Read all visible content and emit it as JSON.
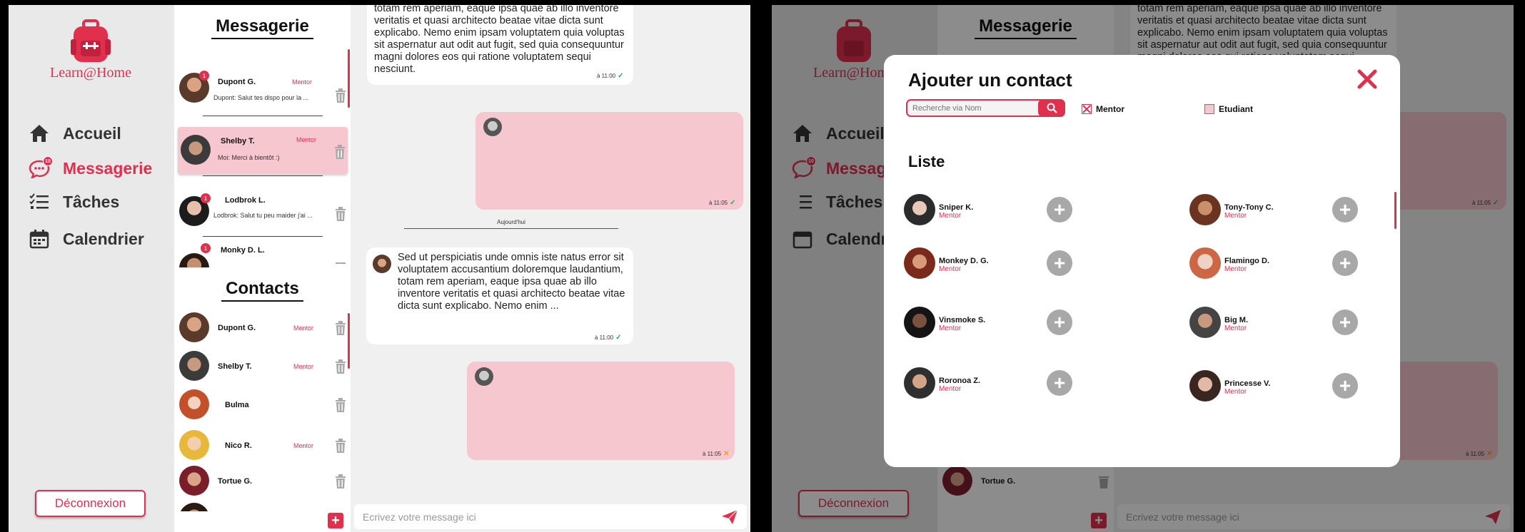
{
  "app": {
    "logo_text": "Learn@Home",
    "accent": "#e0304e",
    "pink": "#f6c7cf"
  },
  "nav": {
    "items": [
      {
        "label": "Accueil",
        "icon": "home-icon"
      },
      {
        "label": "Messagerie",
        "icon": "chat-bubble-icon",
        "badge": "10"
      },
      {
        "label": "Tâches",
        "icon": "checklist-icon"
      },
      {
        "label": "Calendrier",
        "icon": "calendar-icon"
      }
    ],
    "logout": "Déconnexion"
  },
  "messagerie": {
    "title": "Messagerie",
    "conversations": [
      {
        "name": "Dupont G.",
        "tag": "Mentor",
        "preview": "Dupont:  Salut tes dispo pour la ...",
        "badge": "1"
      },
      {
        "name": "Shelby T.",
        "tag": "Mentor",
        "preview": "Moi: Merci à bientôt :)"
      },
      {
        "name": "Lodbrok L.",
        "tag": "",
        "preview": "Lodbrok: Salut tu peu maider j'ai ...",
        "badge": "1"
      },
      {
        "name": "Monky D. L.",
        "tag": "",
        "preview": "",
        "badge": "1"
      }
    ]
  },
  "contacts": {
    "title": "Contacts",
    "items": [
      {
        "name": "Dupont G.",
        "tag": "Mentor"
      },
      {
        "name": "Shelby T.",
        "tag": "Mentor"
      },
      {
        "name": "Bulma",
        "tag": ""
      },
      {
        "name": "Nico R.",
        "tag": "Mentor"
      },
      {
        "name": "Tortue G.",
        "tag": ""
      }
    ]
  },
  "chat": {
    "msg1_text": "totam rem aperiam, eaque ipsa quae ab illo inventore veritatis et quasi architecto beatae vitae dicta sunt explicabo. Nemo enim ipsam voluptatem quia voluptas sit aspernatur aut odit aut fugit, sed quia consequuntur magni dolores eos qui ratione voluptatem sequi nesciunt.",
    "msg1_time": "à 11:00",
    "msg2_time": "à 11:05",
    "day_label": "Aujourd'hui",
    "msg3_text": "Sed ut perspiciatis unde omnis iste natus error sit voluptatem accusantium doloremque laudantium, totam rem aperiam, eaque ipsa quae ab illo inventore veritatis et quasi architecto beatae vitae dicta sunt explicabo. Nemo enim ...",
    "msg3_time": "à 11:00",
    "msg4_time": "à 11:05",
    "input_placeholder": "Ecrivez votre message ici"
  },
  "modal": {
    "title": "Ajouter un contact",
    "search_placeholder": "Recherche via Nom",
    "filter_mentor": "Mentor",
    "filter_student": "Etudiant",
    "list_title": "Liste",
    "contacts": [
      {
        "name": "Sniper K.",
        "tag": "Mentor"
      },
      {
        "name": "Tony-Tony C.",
        "tag": "Mentor"
      },
      {
        "name": "Monkey D. G.",
        "tag": "Mentor"
      },
      {
        "name": "Flamingo D.",
        "tag": "Mentor"
      },
      {
        "name": "Vinsmoke S.",
        "tag": "Mentor"
      },
      {
        "name": "Big M.",
        "tag": "Mentor"
      },
      {
        "name": "Roronoa Z.",
        "tag": "Mentor"
      },
      {
        "name": "Princesse V.",
        "tag": "Mentor"
      }
    ]
  }
}
